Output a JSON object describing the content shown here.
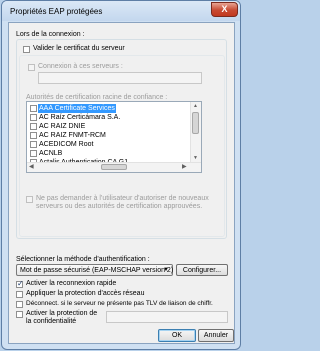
{
  "window": {
    "title": "Propriétés EAP protégées",
    "close_label": "X"
  },
  "connection": {
    "label": "Lors de la connexion :",
    "validate_cert": {
      "label": "Valider le certificat du serveur",
      "checked": false
    },
    "connect_servers": {
      "label": "Connexion à ces serveurs :",
      "checked": false,
      "value": ""
    },
    "trusted_ca_label": "Autorités de certification racine de confiance :",
    "ca_list": [
      {
        "label": "AAA Certificate Services",
        "checked": false,
        "selected": true
      },
      {
        "label": "AC Raíz Certicámara S.A.",
        "checked": false,
        "selected": false
      },
      {
        "label": "AC RAIZ DNIE",
        "checked": false,
        "selected": false
      },
      {
        "label": "AC RAIZ FNMT-RCM",
        "checked": false,
        "selected": false
      },
      {
        "label": "ACEDICOM Root",
        "checked": false,
        "selected": false
      },
      {
        "label": "ACNLB",
        "checked": false,
        "selected": false
      },
      {
        "label": "Actalis Authentication CA G1",
        "checked": false,
        "selected": false
      }
    ],
    "no_prompt": {
      "line1": "Ne pas demander à l'utilisateur d'autoriser de nouveaux",
      "line2": "serveurs ou des autorités de certification approuvées.",
      "checked": false
    }
  },
  "auth": {
    "label": "Sélectionner la méthode d'authentification :",
    "method": "Mot de passe sécurisé (EAP-MSCHAP version 2)",
    "configure_label": "Configurer..."
  },
  "options": [
    {
      "label": "Activer la reconnexion rapide",
      "checked": true
    },
    {
      "label": "Appliquer la protection d'accès réseau",
      "checked": false
    },
    {
      "label": "Déconnect. si le serveur ne présente pas TLV de liaison de chiffr.",
      "checked": false
    },
    {
      "label": "Activer la protection de",
      "label2": "la confidentialité",
      "checked": false
    }
  ],
  "identity_value": "",
  "buttons": {
    "ok": "OK",
    "cancel": "Annuler"
  }
}
